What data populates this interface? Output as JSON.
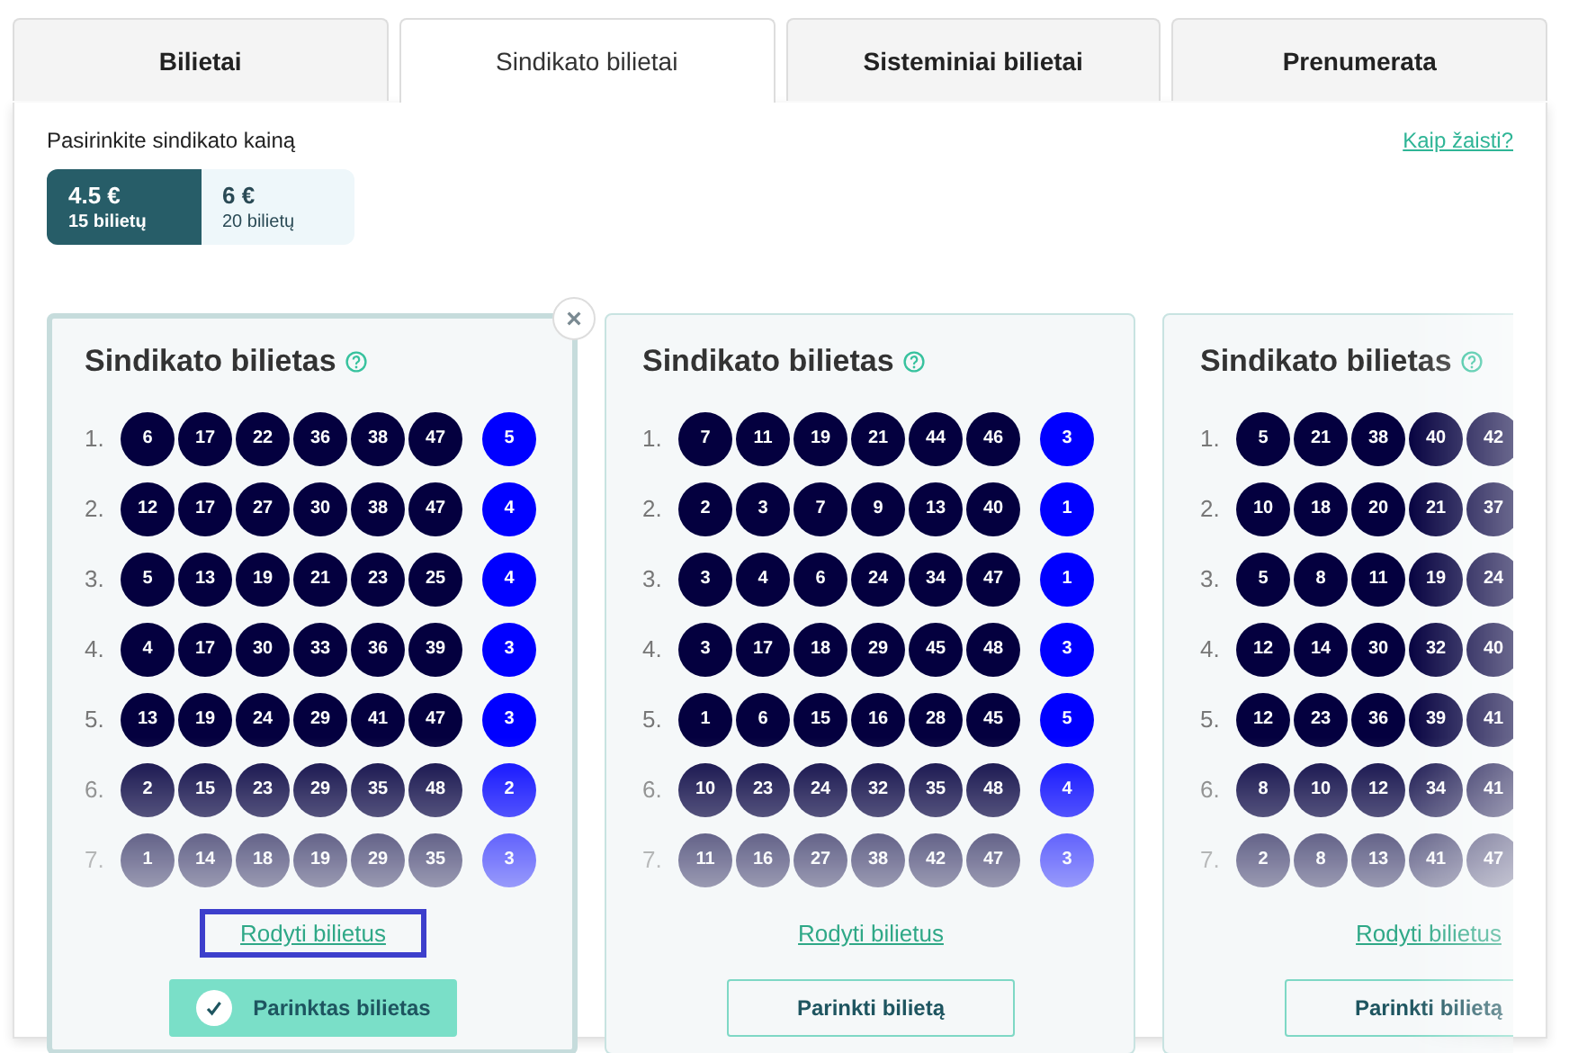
{
  "tabs": [
    {
      "label": "Bilietai",
      "selected": false
    },
    {
      "label": "Sindikato bilietai",
      "selected": true
    },
    {
      "label": "Sisteminiai bilietai",
      "selected": false
    },
    {
      "label": "Prenumerata",
      "selected": false
    }
  ],
  "price_prompt": "Pasirinkite sindikato kainą",
  "help_link": "Kaip žaisti?",
  "price_options": [
    {
      "price": "4.5 €",
      "tickets": "15 bilietų",
      "selected": true
    },
    {
      "price": "6 €",
      "tickets": "20 bilietų",
      "selected": false
    }
  ],
  "cards": [
    {
      "title": "Sindikato bilietas",
      "selected": true,
      "close": "×",
      "link_focused": true,
      "show_link": "Rodyti bilietus",
      "button": "Parinktas bilietas",
      "lines": [
        {
          "label": "1.",
          "numbers": [
            "6",
            "17",
            "22",
            "36",
            "38",
            "47"
          ],
          "bonus": "5"
        },
        {
          "label": "2.",
          "numbers": [
            "12",
            "17",
            "27",
            "30",
            "38",
            "47"
          ],
          "bonus": "4"
        },
        {
          "label": "3.",
          "numbers": [
            "5",
            "13",
            "19",
            "21",
            "23",
            "25"
          ],
          "bonus": "4"
        },
        {
          "label": "4.",
          "numbers": [
            "4",
            "17",
            "30",
            "33",
            "36",
            "39"
          ],
          "bonus": "3"
        },
        {
          "label": "5.",
          "numbers": [
            "13",
            "19",
            "24",
            "29",
            "41",
            "47"
          ],
          "bonus": "3"
        },
        {
          "label": "6.",
          "numbers": [
            "2",
            "15",
            "23",
            "29",
            "35",
            "48"
          ],
          "bonus": "2"
        },
        {
          "label": "7.",
          "numbers": [
            "1",
            "14",
            "18",
            "19",
            "29",
            "35"
          ],
          "bonus": "3"
        }
      ]
    },
    {
      "title": "Sindikato bilietas",
      "selected": false,
      "link_focused": false,
      "show_link": "Rodyti bilietus",
      "button": "Parinkti bilietą",
      "lines": [
        {
          "label": "1.",
          "numbers": [
            "7",
            "11",
            "19",
            "21",
            "44",
            "46"
          ],
          "bonus": "3"
        },
        {
          "label": "2.",
          "numbers": [
            "2",
            "3",
            "7",
            "9",
            "13",
            "40"
          ],
          "bonus": "1"
        },
        {
          "label": "3.",
          "numbers": [
            "3",
            "4",
            "6",
            "24",
            "34",
            "47"
          ],
          "bonus": "1"
        },
        {
          "label": "4.",
          "numbers": [
            "3",
            "17",
            "18",
            "29",
            "45",
            "48"
          ],
          "bonus": "3"
        },
        {
          "label": "5.",
          "numbers": [
            "1",
            "6",
            "15",
            "16",
            "28",
            "45"
          ],
          "bonus": "5"
        },
        {
          "label": "6.",
          "numbers": [
            "10",
            "23",
            "24",
            "32",
            "35",
            "48"
          ],
          "bonus": "4"
        },
        {
          "label": "7.",
          "numbers": [
            "11",
            "16",
            "27",
            "38",
            "42",
            "47"
          ],
          "bonus": "3"
        }
      ]
    },
    {
      "title": "Sindikato bilietas",
      "selected": false,
      "link_focused": false,
      "show_link": "Rodyti bilietus",
      "button": "Parinkti bilietą",
      "lines": [
        {
          "label": "1.",
          "numbers": [
            "5",
            "21",
            "38",
            "40",
            "42"
          ]
        },
        {
          "label": "2.",
          "numbers": [
            "10",
            "18",
            "20",
            "21",
            "37"
          ]
        },
        {
          "label": "3.",
          "numbers": [
            "5",
            "8",
            "11",
            "19",
            "24"
          ]
        },
        {
          "label": "4.",
          "numbers": [
            "12",
            "14",
            "30",
            "32",
            "40"
          ]
        },
        {
          "label": "5.",
          "numbers": [
            "12",
            "23",
            "36",
            "39",
            "41"
          ]
        },
        {
          "label": "6.",
          "numbers": [
            "8",
            "10",
            "12",
            "34",
            "41"
          ]
        },
        {
          "label": "7.",
          "numbers": [
            "2",
            "8",
            "13",
            "41",
            "47"
          ]
        }
      ]
    }
  ]
}
